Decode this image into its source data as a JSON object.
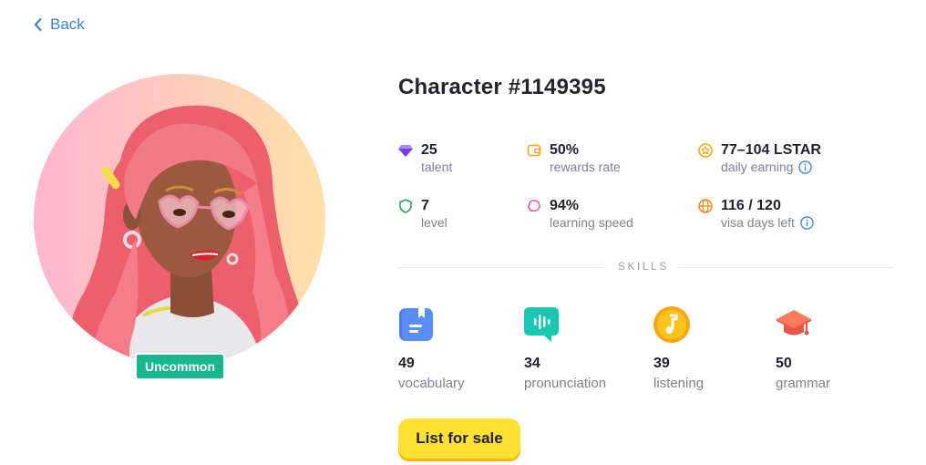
{
  "nav": {
    "back_label": "Back"
  },
  "character": {
    "title": "Character #1149395",
    "rarity": "Uncommon"
  },
  "stats": {
    "talent": {
      "value": "25",
      "label": "talent",
      "icon": "diamond-icon"
    },
    "rewards": {
      "value": "50%",
      "label": "rewards rate",
      "icon": "wallet-icon"
    },
    "earning": {
      "value": "77–104 LSTAR",
      "label": "daily earning",
      "icon": "star-coin-icon"
    },
    "level": {
      "value": "7",
      "label": "level",
      "icon": "shield-icon"
    },
    "learning": {
      "value": "94%",
      "label": "learning speed",
      "icon": "brain-icon"
    },
    "visa": {
      "value": "116 / 120",
      "label": "visa days left",
      "icon": "globe-icon"
    }
  },
  "skills_heading": "SKILLS",
  "skills": {
    "vocabulary": {
      "value": "49",
      "label": "vocabulary",
      "icon": "bookmark-book-icon"
    },
    "pronunciation": {
      "value": "34",
      "label": "pronunciation",
      "icon": "voice-bubble-icon"
    },
    "listening": {
      "value": "39",
      "label": "listening",
      "icon": "music-note-icon"
    },
    "grammar": {
      "value": "50",
      "label": "grammar",
      "icon": "graduation-cap-icon"
    }
  },
  "actions": {
    "list_for_sale": "List for sale"
  },
  "colors": {
    "accent_link": "#3b82d6",
    "rarity_badge": "#17b890",
    "cta": "#ffe033",
    "talent_icon": "#8b5cf6",
    "rewards_icon": "#f5a623",
    "level_icon": "#22a55b",
    "learning_icon": "#ef5b8a",
    "globe_icon": "#f08c1a",
    "info_icon": "#3b82d6"
  }
}
